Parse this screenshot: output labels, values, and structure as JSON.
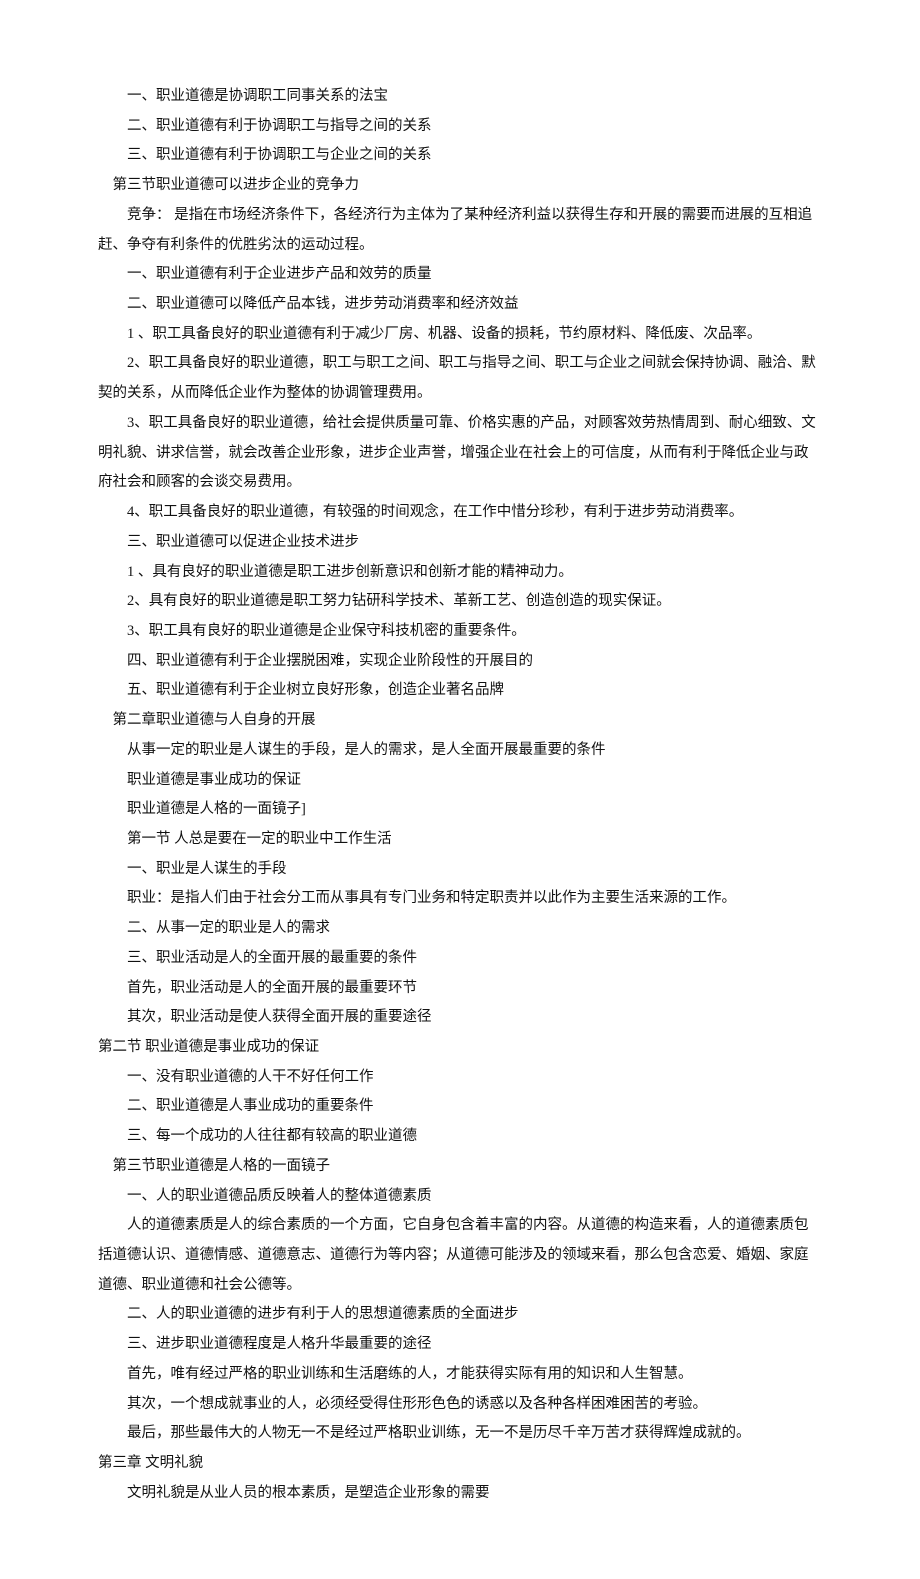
{
  "lines": [
    {
      "indent": 2,
      "text": "一、职业道德是协调职工同事关系的法宝"
    },
    {
      "indent": 2,
      "text": "二、职业道德有利于协调职工与指导之间的关系"
    },
    {
      "indent": 2,
      "text": "三、职业道德有利于协调职工与企业之间的关系"
    },
    {
      "indent": 1,
      "text": "第三节职业道德可以进步企业的竞争力"
    },
    {
      "indent": 2,
      "text": "竞争： 是指在市场经济条件下，各经济行为主体为了某种经济利益以获得生存和开展的需要而进展的互相追赶、争夺有利条件的优胜劣汰的运动过程。"
    },
    {
      "indent": 2,
      "text": "一、职业道德有利于企业进步产品和效劳的质量"
    },
    {
      "indent": 2,
      "text": "二、职业道德可以降低产品本钱，进步劳动消费率和经济效益"
    },
    {
      "indent": 2,
      "text": "1 、职工具备良好的职业道德有利于减少厂房、机器、设备的损耗，节约原材料、降低废、次品率。"
    },
    {
      "indent": 2,
      "text": "2、职工具备良好的职业道德，职工与职工之间、职工与指导之间、职工与企业之间就会保持协调、融洽、默契的关系，从而降低企业作为整体的协调管理费用。"
    },
    {
      "indent": 2,
      "text": "3、职工具备良好的职业道德，给社会提供质量可靠、价格实惠的产品，对顾客效劳热情周到、耐心细致、文明礼貌、讲求信誉，就会改善企业形象，进步企业声誉，增强企业在社会上的可信度，从而有利于降低企业与政府社会和顾客的会谈交易费用。"
    },
    {
      "indent": 2,
      "text": "4、职工具备良好的职业道德，有较强的时间观念，在工作中惜分珍秒，有利于进步劳动消费率。"
    },
    {
      "indent": 2,
      "text": "三、职业道德可以促进企业技术进步"
    },
    {
      "indent": 2,
      "text": "1 、具有良好的职业道德是职工进步创新意识和创新才能的精神动力。"
    },
    {
      "indent": 2,
      "text": "2、具有良好的职业道德是职工努力钻研科学技术、革新工艺、创造创造的现实保证。"
    },
    {
      "indent": 2,
      "text": "3、职工具有良好的职业道德是企业保守科技机密的重要条件。"
    },
    {
      "indent": 2,
      "text": "四、职业道德有利于企业摆脱困难，实现企业阶段性的开展目的"
    },
    {
      "indent": 2,
      "text": "五、职业道德有利于企业树立良好形象，创造企业著名品牌"
    },
    {
      "indent": 1,
      "text": "第二章职业道德与人自身的开展"
    },
    {
      "indent": 2,
      "text": "从事一定的职业是人谋生的手段，是人的需求，是人全面开展最重要的条件"
    },
    {
      "indent": 2,
      "text": "职业道德是事业成功的保证"
    },
    {
      "indent": 2,
      "text": "职业道德是人格的一面镜子]"
    },
    {
      "indent": 2,
      "text": "第一节  人总是要在一定的职业中工作生活"
    },
    {
      "indent": 2,
      "text": "一、职业是人谋生的手段"
    },
    {
      "indent": 2,
      "text": "职业：是指人们由于社会分工而从事具有专门业务和特定职责并以此作为主要生活来源的工作。"
    },
    {
      "indent": 2,
      "text": "二、从事一定的职业是人的需求"
    },
    {
      "indent": 2,
      "text": "三、职业活动是人的全面开展的最重要的条件"
    },
    {
      "indent": 2,
      "text": "首先，职业活动是人的全面开展的最重要环节"
    },
    {
      "indent": 2,
      "text": "其次，职业活动是使人获得全面开展的重要途径"
    },
    {
      "indent": 0,
      "text": "第二节  职业道德是事业成功的保证"
    },
    {
      "indent": 2,
      "text": "一、没有职业道德的人干不好任何工作"
    },
    {
      "indent": 2,
      "text": "二、职业道德是人事业成功的重要条件"
    },
    {
      "indent": 2,
      "text": "三、每一个成功的人往往都有较高的职业道德"
    },
    {
      "indent": 1,
      "text": "第三节职业道德是人格的一面镜子"
    },
    {
      "indent": 2,
      "text": "一、人的职业道德品质反映着人的整体道德素质"
    },
    {
      "indent": 2,
      "text": "人的道德素质是人的综合素质的一个方面，它自身包含着丰富的内容。从道德的构造来看，人的道德素质包括道德认识、道德情感、道德意志、道德行为等内容；从道德可能涉及的领域来看，那么包含恋爱、婚姻、家庭道德、职业道德和社会公德等。"
    },
    {
      "indent": 2,
      "text": "二、人的职业道德的进步有利于人的思想道德素质的全面进步"
    },
    {
      "indent": 2,
      "text": "三、进步职业道德程度是人格升华最重要的途径"
    },
    {
      "indent": 2,
      "text": "首先，唯有经过严格的职业训练和生活磨练的人，才能获得实际有用的知识和人生智慧。"
    },
    {
      "indent": 2,
      "text": "其次，一个想成就事业的人，必须经受得住形形色色的诱惑以及各种各样困难困苦的考验。"
    },
    {
      "indent": 2,
      "text": "最后，那些最伟大的人物无一不是经过严格职业训练，无一不是历尽千辛万苦才获得辉煌成就的。"
    },
    {
      "indent": 0,
      "text": "第三章  文明礼貌"
    },
    {
      "indent": 2,
      "text": "文明礼貌是从业人员的根本素质，是塑造企业形象的需要"
    }
  ]
}
